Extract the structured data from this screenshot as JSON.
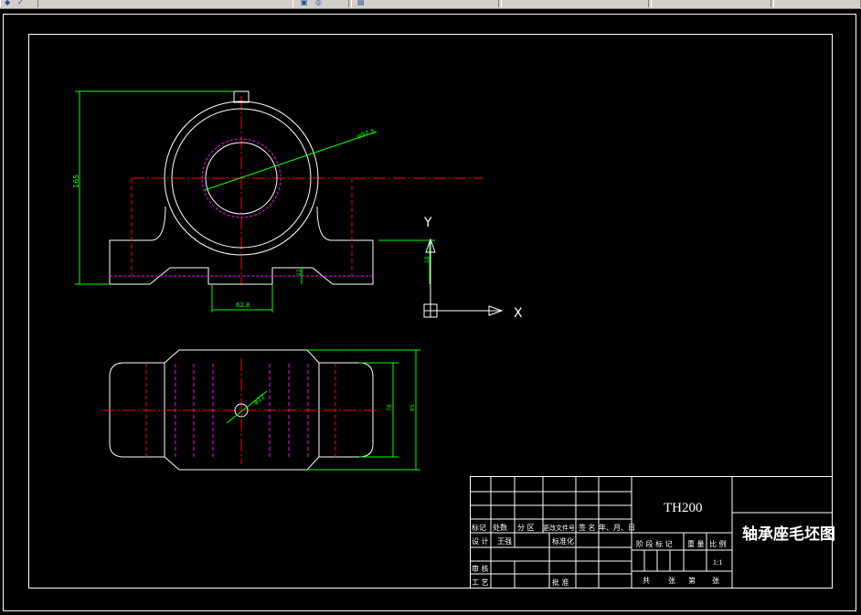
{
  "window": {
    "toolbar_icons": [
      "shield-icon",
      "check-icon",
      "open-folder-icon",
      "history-icon",
      "lock-icon"
    ]
  },
  "drawing": {
    "dimensions": {
      "height_total": "165",
      "bore_diameter": "φ97.5",
      "base_thickness": "22",
      "base_gap": "62.8",
      "axis_offset": "18",
      "hole_diameter": "φ12",
      "plan_inner_width": "78",
      "plan_outer_width": "85"
    },
    "axis_labels": {
      "y": "Y",
      "x": "X"
    }
  },
  "title_block": {
    "drawing_number": "TH200",
    "drawing_name": "轴承座毛坯图",
    "revision_headers": [
      "标记",
      "处数",
      "分 区",
      "更改文件号",
      "签 名",
      "年、月、日"
    ],
    "design_label": "设 计",
    "designer": "王强",
    "standardization_label": "标准化",
    "review_label": "审 核",
    "process_label": "工 艺",
    "approve_label": "批 准",
    "stage_label": "阶 段 标 记",
    "weight_label": "重 量",
    "scale_label": "比 例",
    "scale_value": "1:1",
    "sheets_total_label": "共",
    "sheets_unit_label": "张",
    "sheet_current_label": "第",
    "sheet_unit2_label": "张"
  },
  "colors": {
    "background": "#000000",
    "outline": "#ffffff",
    "centerline": "#ff0000",
    "dimension": "#00ff00",
    "hidden": "#ff00ff"
  }
}
